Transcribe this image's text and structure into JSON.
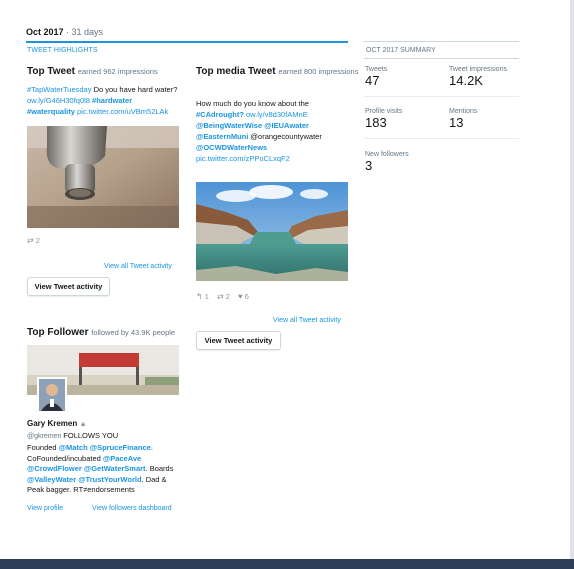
{
  "header": {
    "period": "Oct 2017",
    "separator": " · ",
    "days": "31 days"
  },
  "highlights": {
    "section_title": "TWEET HIGHLIGHTS",
    "top_tweet": {
      "heading": "Top Tweet",
      "sub": "earned 962 impressions",
      "text_parts": {
        "hashtag1": "#TapWaterTuesday",
        "plain1": " Do you have hard water? ",
        "link1": "ow.ly/G46H30fq0l8",
        "hashtag2": " #hardwater",
        "hashtag3": "#waterquality",
        "link2": " pic.twitter.com/uVBm52LAk"
      },
      "retweets": "2",
      "view_all": "View all Tweet activity",
      "button": "View Tweet activity"
    },
    "top_media_tweet": {
      "heading": "Top media Tweet",
      "sub": "earned 800 impressions",
      "text_parts": {
        "plain1": "How much do you know about the ",
        "hashtag1": "#CAdrought?",
        "link1": " ow.ly/v8d30fAMnE",
        "mention1": "@BeingWaterWise",
        "mention2": " @IEUAwater",
        "mention3": "@EasternMuni",
        "mention4": "@OCWDWaterNews",
        "plain2": " @orangecountywater",
        "link2": "pic.twitter.com/zPPuCLxqF2"
      },
      "replies": "1",
      "retweets": "2",
      "likes": "6",
      "view_all": "View all Tweet activity",
      "button": "View Tweet activity"
    },
    "top_follower": {
      "heading": "Top Follower",
      "sub": "followed by 43.9K people",
      "name": "Gary Kremen",
      "handle": "@gkremen",
      "follows_you": "FOLLOWS YOU",
      "bio_parts": {
        "p1": "Founded ",
        "m1": "@Match",
        "m2": " @SpruceFinance",
        "p2": ". CoFounded/incubated ",
        "m3": "@PaceAve",
        "m4": "@CrowdFlower",
        "m5": " @GetWaterSmart",
        "p3": ". Boards ",
        "m6": "@ValleyWater",
        "m7": " @TrustYourWorld",
        "p4": ". Dad & Peak bagger. RT≠endorsements"
      },
      "view_profile": "View profile",
      "view_dashboard": "View followers dashboard"
    }
  },
  "summary": {
    "title": "OCT 2017 SUMMARY",
    "tweets_label": "Tweets",
    "tweets_value": "47",
    "impressions_label": "Tweet impressions",
    "impressions_value": "14.2K",
    "profile_visits_label": "Profile visits",
    "profile_visits_value": "183",
    "mentions_label": "Mentions",
    "mentions_value": "13",
    "new_followers_label": "New followers",
    "new_followers_value": "3"
  },
  "colors": {
    "accent": "#1b95e0",
    "muted": "#657786",
    "bottom_bar": "#2c3f57"
  }
}
